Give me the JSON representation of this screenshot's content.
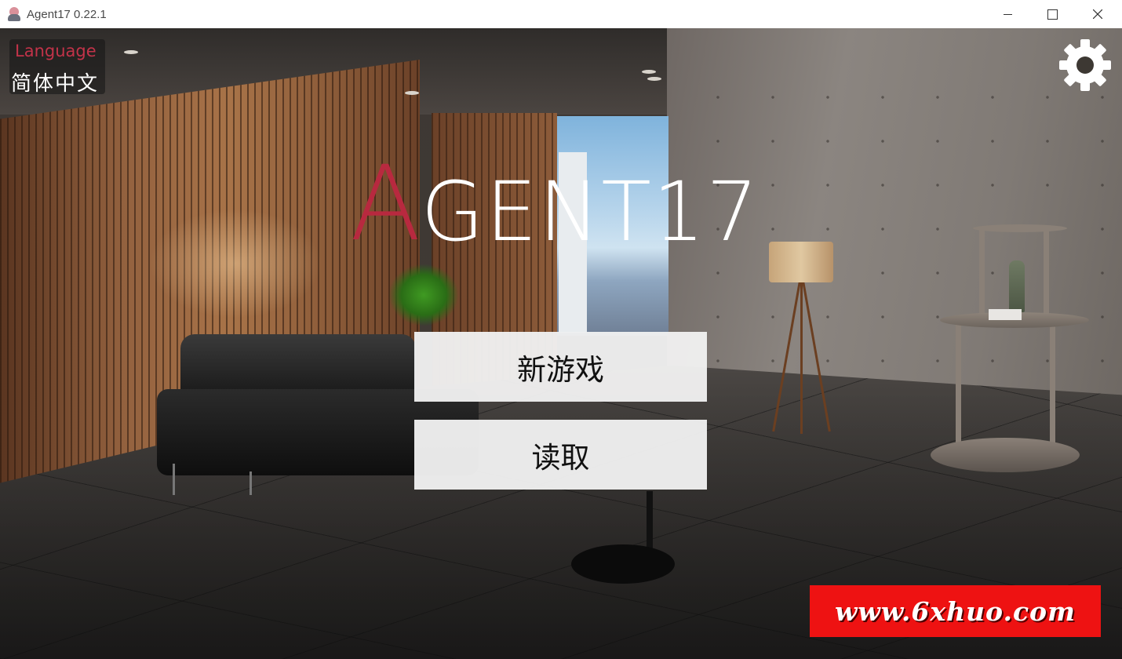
{
  "window": {
    "title": "Agent17 0.22.1",
    "minimize_icon": "minimize-icon",
    "maximize_icon": "maximize-icon",
    "close_icon": "close-icon"
  },
  "language": {
    "label": "Language",
    "value": "简体中文"
  },
  "settings": {
    "icon": "gear-icon"
  },
  "logo": {
    "first_letter": "A",
    "rest": "GENT17",
    "accent_color": "#b8293f"
  },
  "menu": {
    "new_game": "新游戏",
    "load": "读取"
  },
  "watermark": {
    "text": "www.6xhuo.com"
  }
}
